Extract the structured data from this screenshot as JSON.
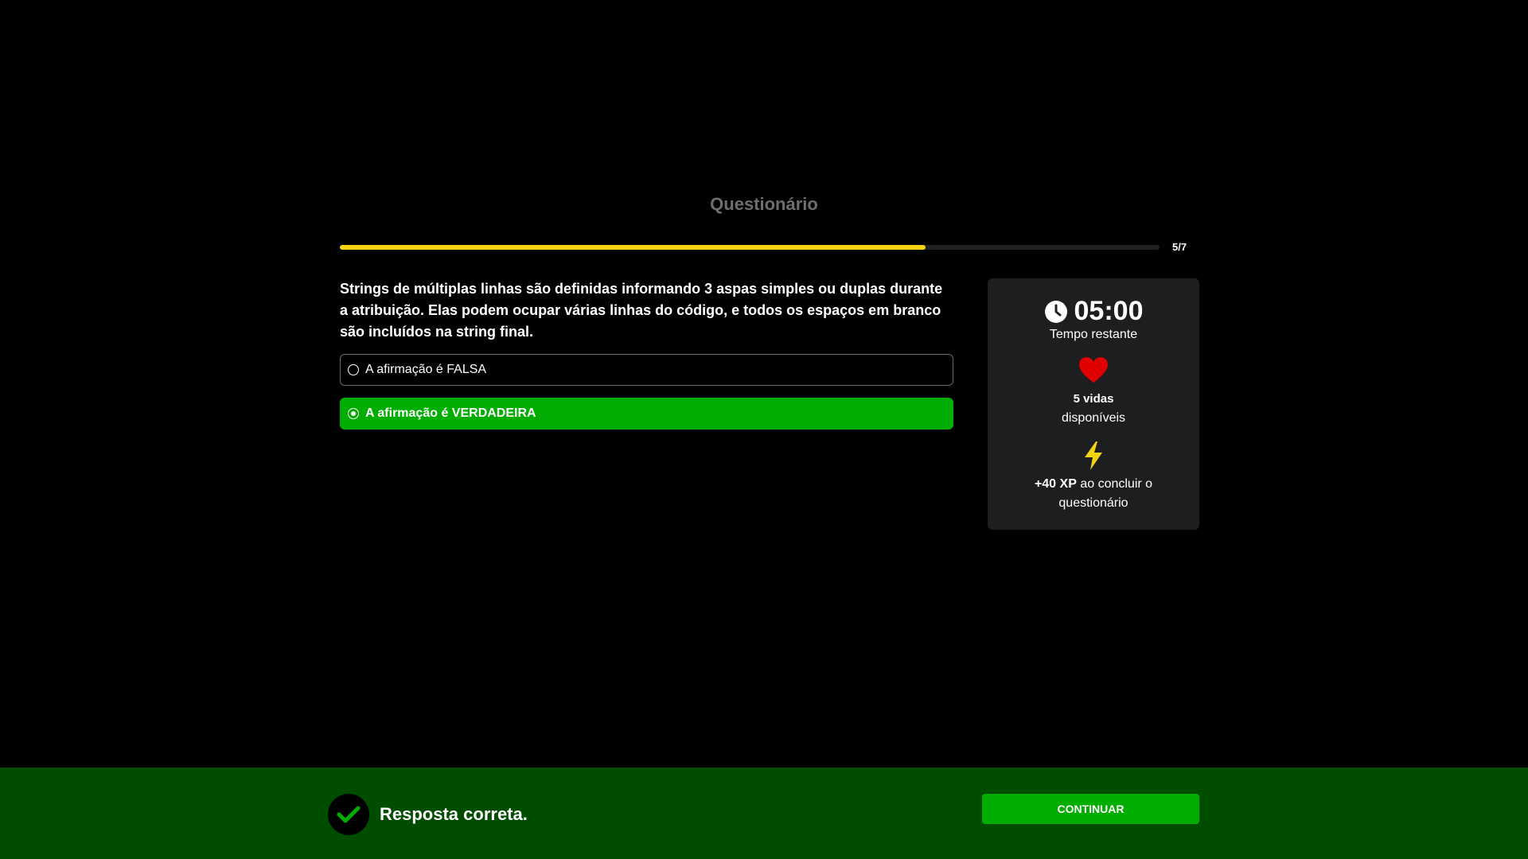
{
  "header": {
    "title": "Questionário"
  },
  "progress": {
    "current": 5,
    "total": 7,
    "label": "5/7",
    "fill_percent": 71.5,
    "color": "#f5d30f"
  },
  "question": {
    "text": "Strings de múltiplas linhas são definidas informando 3 aspas simples ou duplas durante a atribuição. Elas podem ocupar várias linhas do código, e todos os espaços em branco são incluídos na string final.",
    "options": [
      {
        "label": "A afirmação é FALSA",
        "selected": false
      },
      {
        "label": "A afirmação é VERDADEIRA",
        "selected": true
      }
    ]
  },
  "sidebar": {
    "timer": {
      "value": "05:00",
      "label": "Tempo restante",
      "icon": "clock-icon"
    },
    "lives": {
      "count_label": "5 vidas",
      "sub_label": "disponíveis",
      "icon": "heart-icon",
      "color": "#e00000"
    },
    "xp": {
      "amount_label": "+40 XP",
      "rest_label": " ao concluir o questionário",
      "icon": "lightning-icon",
      "color": "#f5d30f"
    }
  },
  "feedback": {
    "text": "Resposta correta.",
    "button_label": "CONTINUAR",
    "icon": "check-icon",
    "bar_color": "#004d00",
    "accent_color": "#00ad00"
  }
}
